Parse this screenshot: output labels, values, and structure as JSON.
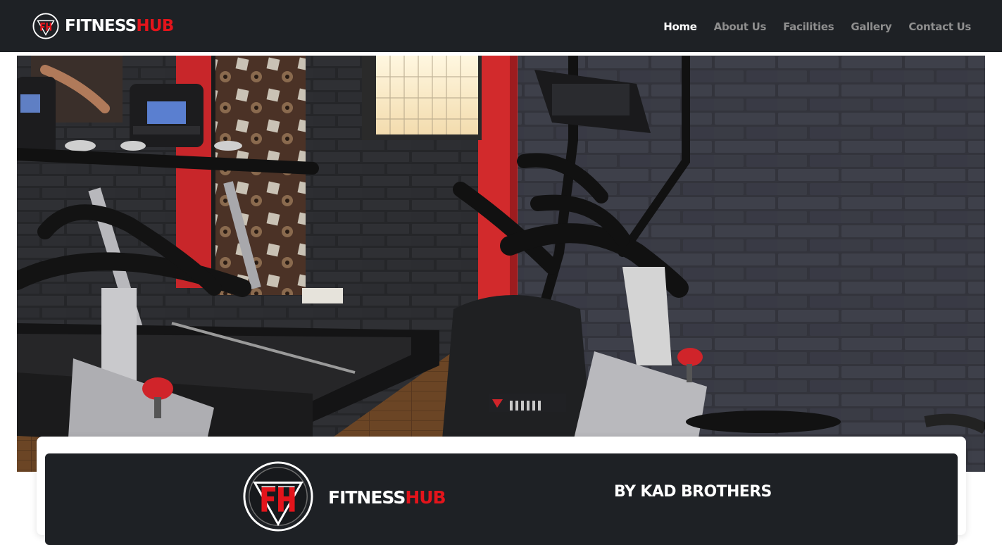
{
  "brand": {
    "part1": "FITNESS",
    "part2": "HUB"
  },
  "nav": {
    "items": [
      {
        "label": "Home",
        "active": true
      },
      {
        "label": "About Us",
        "active": false
      },
      {
        "label": "Facilities",
        "active": false
      },
      {
        "label": "Gallery",
        "active": false
      },
      {
        "label": "Contact Us",
        "active": false
      }
    ]
  },
  "hero": {
    "image": "gym-interior-photo"
  },
  "card": {
    "brand_part1": "FITNESS",
    "brand_part2": "HUB",
    "tagline": "BY KAD BROTHERS"
  },
  "colors": {
    "dark": "#1e2125",
    "accent": "#e3141b",
    "nav_inactive": "#8e8e8e"
  }
}
